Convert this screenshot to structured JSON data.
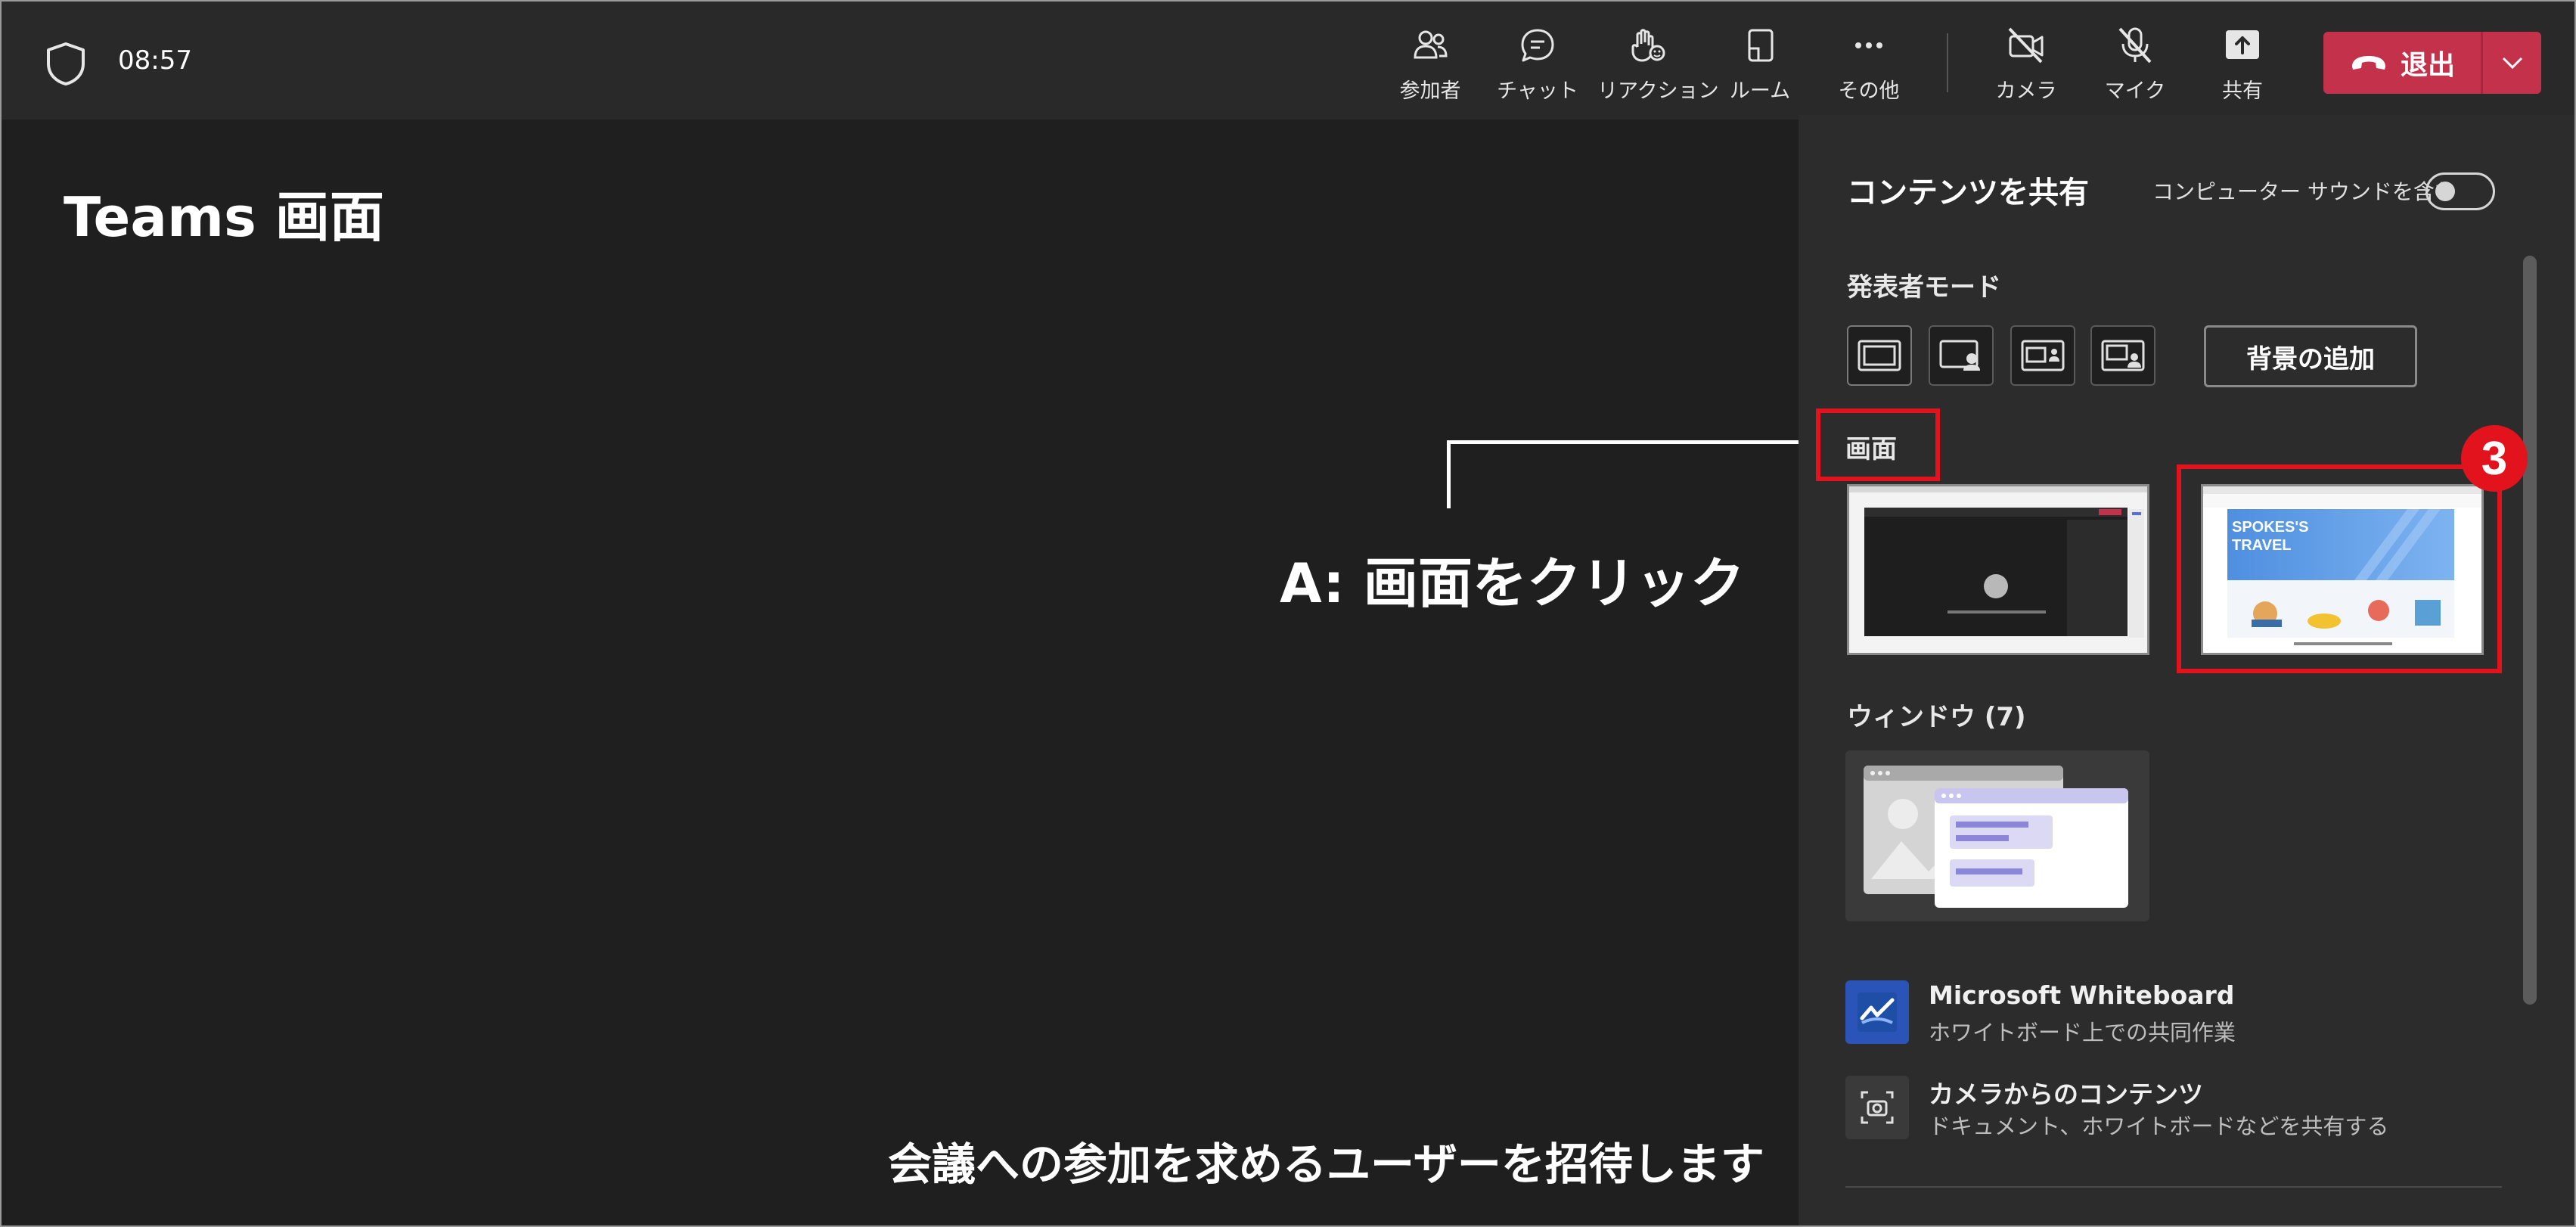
{
  "header": {
    "time": "08:57",
    "toolbar": [
      {
        "id": "participants",
        "label": "参加者",
        "icon": "people-icon"
      },
      {
        "id": "chat",
        "label": "チャット",
        "icon": "chat-icon"
      },
      {
        "id": "reactions",
        "label": "リアクション",
        "icon": "hand-icon"
      },
      {
        "id": "rooms",
        "label": "ルーム",
        "icon": "rooms-icon"
      },
      {
        "id": "more",
        "label": "その他",
        "icon": "more-icon"
      },
      {
        "id": "camera",
        "label": "カメラ",
        "icon": "camera-off-icon"
      },
      {
        "id": "mic",
        "label": "マイク",
        "icon": "mic-off-icon"
      },
      {
        "id": "share",
        "label": "共有",
        "icon": "share-icon"
      }
    ],
    "leave_label": "退出",
    "leave_color": "#c4314b"
  },
  "stage": {
    "title": "Teams 画面",
    "callout": "A: 画面をクリック",
    "invite": "会議への参加を求めるユーザーを招待します"
  },
  "panel": {
    "title": "コンテンツを共有",
    "sound_label": "コンピューター サウンドを含む",
    "sound_on": false,
    "presenter_mode_label": "発表者モード",
    "background_button": "背景の追加",
    "screen_label": "画面",
    "screen_thumbs": [
      "teams-meeting-screen",
      "spokes-travel-screen"
    ],
    "spokes_title_line1": "SPOKES'S",
    "spokes_title_line2": "TRAVEL",
    "step_badge": "3",
    "window_label": "ウィンドウ (7)",
    "apps": [
      {
        "name": "Microsoft Whiteboard",
        "sub": "ホワイトボード上での共同作業",
        "icon": "whiteboard-icon"
      },
      {
        "name": "カメラからのコンテンツ",
        "sub": "ドキュメント、ホワイトボードなどを共有する",
        "icon": "camera-content-icon"
      }
    ]
  },
  "colors": {
    "highlight": "#e3131d",
    "leave": "#c4314b",
    "panel_bg": "#2c2c2c",
    "stage_bg": "#1f1f1f"
  }
}
